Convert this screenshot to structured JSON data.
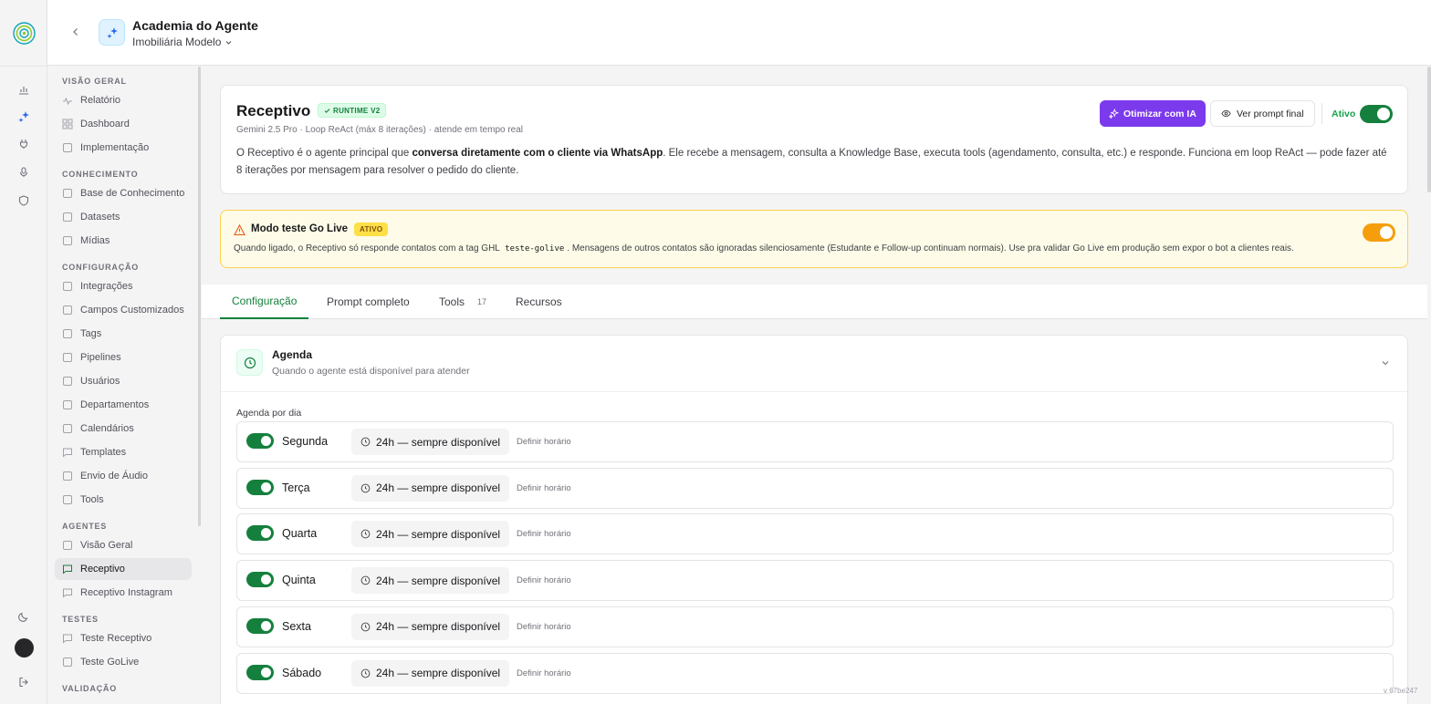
{
  "header": {
    "title": "Academia do Agente",
    "workspace": "Imobiliária Modelo"
  },
  "sidebar": {
    "sections": [
      {
        "title": "VISÃO GERAL",
        "items": [
          "Relatório",
          "Dashboard",
          "Implementação"
        ]
      },
      {
        "title": "CONHECIMENTO",
        "items": [
          "Base de Conhecimento",
          "Datasets",
          "Mídias"
        ]
      },
      {
        "title": "CONFIGURAÇÃO",
        "items": [
          "Integrações",
          "Campos Customizados",
          "Tags",
          "Pipelines",
          "Usuários",
          "Departamentos",
          "Calendários",
          "Templates",
          "Envio de Áudio",
          "Tools"
        ]
      },
      {
        "title": "AGENTES",
        "items": [
          "Visão Geral",
          "Receptivo",
          "Receptivo Instagram"
        ]
      },
      {
        "title": "TESTES",
        "items": [
          "Teste Receptivo",
          "Teste GoLive"
        ]
      },
      {
        "title": "VALIDAÇÃO",
        "items": []
      }
    ],
    "active_item": "Receptivo"
  },
  "agent": {
    "name": "Receptivo",
    "badge": "RUNTIME V2",
    "meta": "Gemini 2.5 Pro · Loop ReAct (máx 8 iterações) · atende em tempo real",
    "desc_1": "O Receptivo é o agente principal que ",
    "desc_bold": "conversa diretamente com o cliente via WhatsApp",
    "desc_2": ". Ele recebe a mensagem, consulta a Knowledge Base, executa tools (agendamento, consulta, etc.) e responde. Funciona em loop ReAct — pode fazer até 8 iterações por mensagem para resolver o pedido do cliente.",
    "btn_optimize": "Otimizar com IA",
    "btn_prompt": "Ver prompt final",
    "status_label": "Ativo",
    "status_on": true
  },
  "golive": {
    "title": "Modo teste Go Live",
    "badge": "ATIVO",
    "desc_1": "Quando ligado, o Receptivo só responde contatos com a tag GHL ",
    "desc_code": "teste-golive",
    "desc_2": ". Mensagens de outros contatos são ignoradas silenciosamente (Estudante e Follow-up continuam normais). Use pra validar Go Live em produção sem expor o bot a clientes reais.",
    "enabled": true
  },
  "tabs": [
    {
      "label": "Configuração",
      "count": ""
    },
    {
      "label": "Prompt completo",
      "count": ""
    },
    {
      "label": "Tools",
      "count": "17"
    },
    {
      "label": "Recursos",
      "count": ""
    }
  ],
  "active_tab": "Configuração",
  "agenda": {
    "title": "Agenda",
    "subtitle": "Quando o agente está disponível para atender",
    "per_day_label": "Agenda por dia",
    "availability_label": "24h — sempre disponível",
    "define_label": "Definir horário",
    "days": [
      {
        "name": "Segunda",
        "on": true
      },
      {
        "name": "Terça",
        "on": true
      },
      {
        "name": "Quarta",
        "on": true
      },
      {
        "name": "Quinta",
        "on": true
      },
      {
        "name": "Sexta",
        "on": true
      },
      {
        "name": "Sábado",
        "on": true
      }
    ]
  },
  "version": "v 67be247",
  "colors": {
    "accent_green": "#15803d",
    "purple": "#7c3aed",
    "warning": "#f59e0b"
  }
}
